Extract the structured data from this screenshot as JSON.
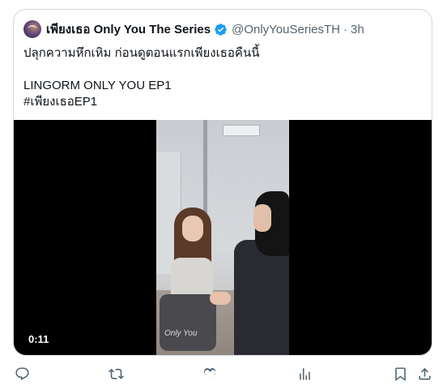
{
  "post": {
    "display_name": "เพียงเธอ Only You The Series",
    "handle": "@OnlyYouSeriesTH",
    "separator": "·",
    "time": "3h",
    "text_lines": [
      "ปลุกความหึกเหิม ก่อนดูตอนแรกเพียงเธอคืนนี้",
      "",
      "LINGORM ONLY YOU EP1",
      "#เพียงเธอEP1"
    ]
  },
  "media": {
    "duration": "0:11",
    "watermark": "Only You"
  },
  "actions": {
    "reply_icon": "reply-icon",
    "repost_icon": "repost-icon",
    "like_icon": "like-icon",
    "views_icon": "views-icon",
    "bookmark_icon": "bookmark-icon",
    "share_icon": "share-icon"
  },
  "colors": {
    "verified": "#1d9bf0",
    "secondary_text": "#536471",
    "border": "#cfd9de"
  }
}
